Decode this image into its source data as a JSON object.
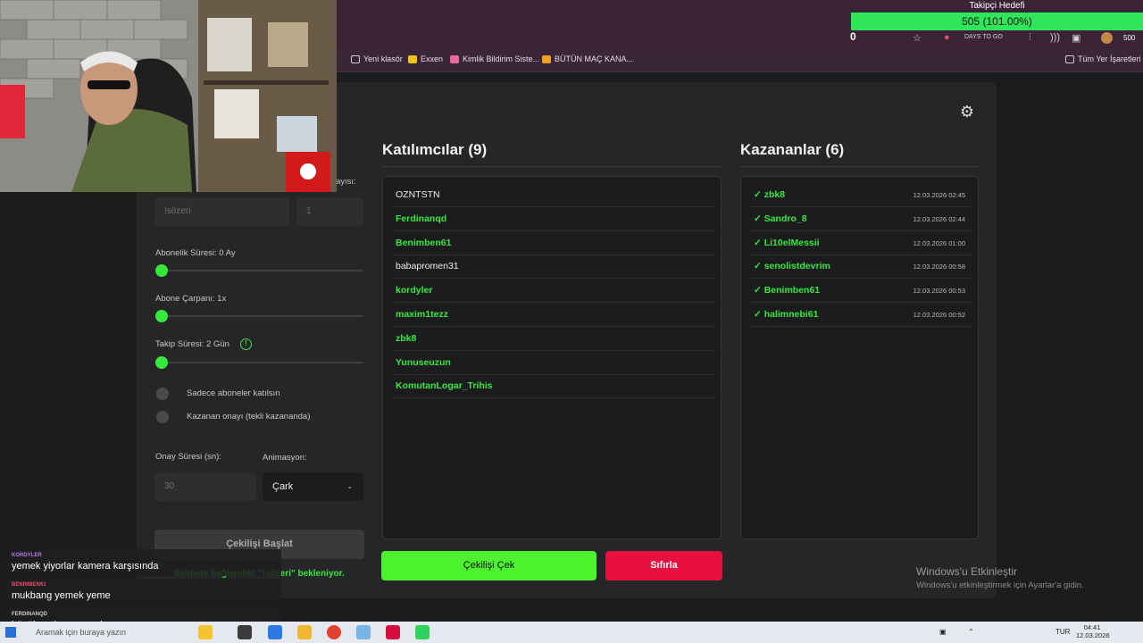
{
  "goal": {
    "title": "Takipçi Hedefi",
    "progress_text": "505 (101.00%)",
    "current": "0",
    "progress_percent": 101
  },
  "browser": {
    "bookmarks": [
      "Yeni klasör",
      "Exxen",
      "Kimlik Bildirim Siste...",
      "BÜTÜN MAÇ KANA..."
    ],
    "all_bookmarks": "Tüm Yer İşaretleri",
    "toolbar_labels": {
      "days": "DAYS TO GO",
      "count": "500"
    }
  },
  "settings": {
    "partial_label": "ayısı:",
    "keyword_placeholder": "!sözeri",
    "count_value": "1",
    "sub_duration_label": "Abonelik Süresi: 0 Ay",
    "sub_multiplier_label": "Abone Çarpanı: 1x",
    "follow_duration_label": "Takip Süresi:",
    "follow_duration_value": "2",
    "follow_duration_unit": "Gün",
    "only_subs_label": "Sadece aboneler katılsın",
    "winner_confirm_label": "Kazanan onayı (tekli kazananda)",
    "confirm_time_label": "Onay Süresi (sn):",
    "confirm_time_value": "30",
    "animation_label": "Animasyon:",
    "animation_value": "Çark",
    "start_button": "Çekilişi Başlat",
    "status_message": "Sohbete bağlanıldı! \"!sözeri\" bekleniyor."
  },
  "participants": {
    "title": "Katılımcılar (9)",
    "items": [
      {
        "name": "OZNTSTN",
        "color": "white"
      },
      {
        "name": "Ferdinanqd",
        "color": "green"
      },
      {
        "name": "Benimben61",
        "color": "green"
      },
      {
        "name": "babapromen31",
        "color": "white"
      },
      {
        "name": "kordyler",
        "color": "green"
      },
      {
        "name": "maxim1tezz",
        "color": "green"
      },
      {
        "name": "zbk8",
        "color": "green"
      },
      {
        "name": "Yunuseuzun",
        "color": "green"
      },
      {
        "name": "KomutanLogar_Trihis",
        "color": "green"
      }
    ]
  },
  "winners": {
    "title": "Kazananlar (6)",
    "items": [
      {
        "name": "✓ zbk8",
        "time": "12.03.2026 02:45"
      },
      {
        "name": "✓ Sandro_8",
        "time": "12.03.2026 02:44"
      },
      {
        "name": "✓ Li10elMessii",
        "time": "12.03.2026 01:00"
      },
      {
        "name": "✓ senolistdevrim",
        "time": "12.03.2026 00:58"
      },
      {
        "name": "✓ Benimben61",
        "time": "12.03.2026 00:53"
      },
      {
        "name": "✓ halimnebi61",
        "time": "12.03.2026 00:52"
      }
    ]
  },
  "actions": {
    "draw": "Çekilişi Çek",
    "reset": "Sıfırla"
  },
  "chat": [
    {
      "user": "KORDYLER",
      "message": "yemek yiyorlar kamera karşısında",
      "color": "#b57be8"
    },
    {
      "user": "BENIMBEN61",
      "message": "mukbang yemek yeme",
      "color": "#e84a6a"
    },
    {
      "user": "FERDINANQD",
      "message": "büyük patlama gangbang",
      "color": "#cccccc"
    }
  ],
  "windows": {
    "activate_title": "Windows'u Etkinleştir",
    "activate_sub": "Windows'u etkinleştirmek için Ayarlar'a gidin.",
    "search_placeholder": "Aramak için buraya yazın",
    "lang": "TUR",
    "time": "04:41",
    "date": "12.03.2026"
  },
  "colors": {
    "accent": "#35e83f",
    "danger": "#e8103f",
    "card": "#262628"
  }
}
